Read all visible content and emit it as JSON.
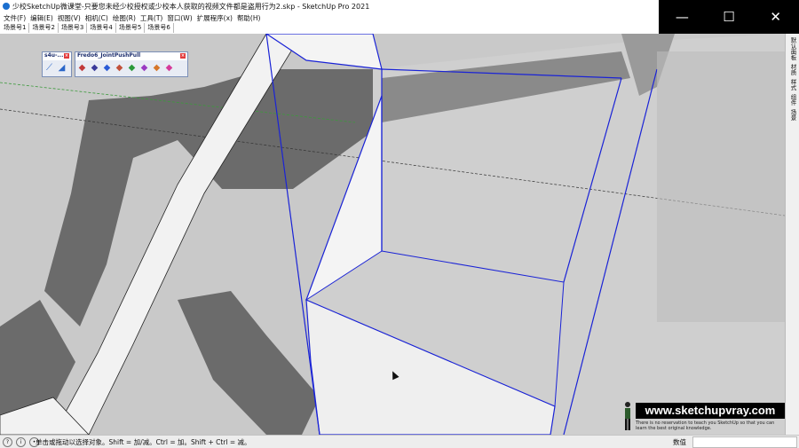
{
  "window": {
    "title": "少校SketchUp微课堂-只要您未经少校授权或少校本人获取的视频文件都是盗用行为2.skp - SketchUp Pro 2021",
    "minimize_glyph": "—",
    "maximize_glyph": "☐",
    "close_glyph": "✕"
  },
  "menu": [
    "文件(F)",
    "编辑(E)",
    "视图(V)",
    "相机(C)",
    "绘图(R)",
    "工具(T)",
    "窗口(W)",
    "扩展程序(x)",
    "帮助(H)"
  ],
  "scene_tabs": [
    "场景号1",
    "场景号2",
    "场景号3",
    "场景号4",
    "场景号5",
    "场景号6"
  ],
  "toolbars": {
    "s4u": {
      "title": "s4u-..."
    },
    "fredo": {
      "title": "Fredo6_JointPushPull"
    }
  },
  "right_panel": [
    "默认面板",
    "材质",
    "样式",
    "组件",
    "场景"
  ],
  "status": {
    "message": "单击或拖动以选择对象。Shift = 加/减。Ctrl = 加。Shift + Ctrl = 减。",
    "value_label": "数值"
  },
  "watermark": {
    "url": "www.sketchupvray.com",
    "tagline": "There is no reservation to teach you SketchUp so that you can learn the best original knowledge."
  },
  "colors": {
    "selection_edge": "#1a23d6",
    "axis_green": "#3c9a3c",
    "axis_red": "#c23a3a",
    "shadow": "#6b6b6b",
    "ground": "#c9c9c9"
  }
}
